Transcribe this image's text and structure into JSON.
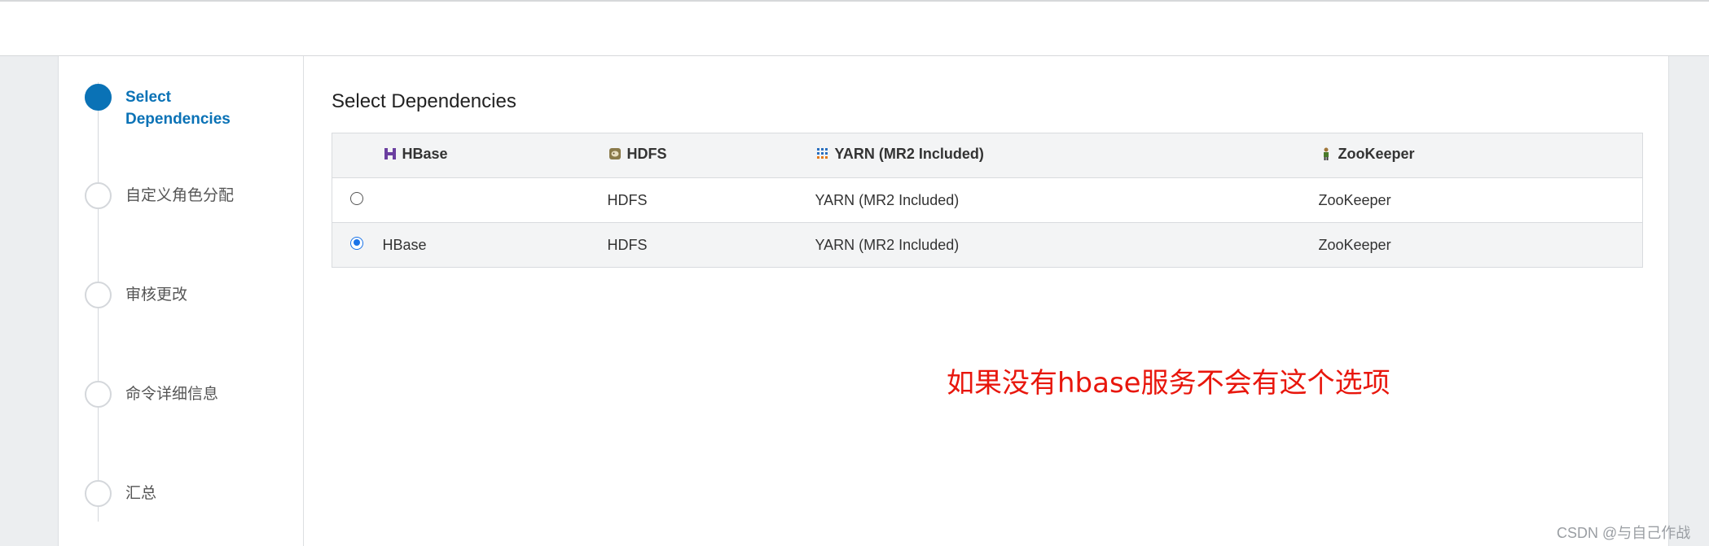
{
  "wizard": {
    "steps": [
      {
        "label": "Select Dependencies",
        "active": true
      },
      {
        "label": "自定义角色分配",
        "active": false
      },
      {
        "label": "审核更改",
        "active": false
      },
      {
        "label": "命令详细信息",
        "active": false
      },
      {
        "label": "汇总",
        "active": false
      }
    ]
  },
  "main": {
    "title": "Select Dependencies",
    "table": {
      "headers": [
        {
          "label": "HBase",
          "icon": "hbase-icon"
        },
        {
          "label": "HDFS",
          "icon": "hdfs-icon"
        },
        {
          "label": "YARN (MR2 Included)",
          "icon": "yarn-icon"
        },
        {
          "label": "ZooKeeper",
          "icon": "zookeeper-icon"
        }
      ],
      "rows": [
        {
          "selected": false,
          "cells": [
            "",
            "HDFS",
            "YARN (MR2 Included)",
            "ZooKeeper"
          ]
        },
        {
          "selected": true,
          "cells": [
            "HBase",
            "HDFS",
            "YARN (MR2 Included)",
            "ZooKeeper"
          ]
        }
      ]
    }
  },
  "annotation": "如果没有hbase服务不会有这个选项",
  "watermark": "CSDN @与自己作战",
  "colors": {
    "accent": "#0a72b6",
    "radio_selected": "#1a73e8",
    "annotation": "#e8160c",
    "icon_hbase": "#6b3fa0",
    "icon_hdfs": "#8a7a4a",
    "icon_yarn_a": "#2a6fbf",
    "icon_yarn_b": "#e27a1a"
  }
}
